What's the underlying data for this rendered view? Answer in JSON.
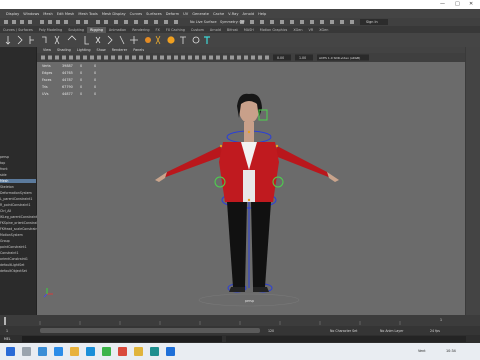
{
  "window": {
    "menus": [
      "Display",
      "Windows",
      "Mesh",
      "Edit Mesh",
      "Mesh Tools",
      "Mesh Display",
      "Curves",
      "Surfaces",
      "Deform",
      "UV",
      "Generate",
      "Cache",
      "V-Ray",
      "Arnold",
      "Help"
    ],
    "controls": [
      "—",
      "□",
      "✕"
    ]
  },
  "statusline": {
    "surface_label": "No Live Surface",
    "symmetry_label": "Symmetry: Off",
    "signin_label": "Sign In"
  },
  "shelf": {
    "tabs": [
      "Curves / Surfaces",
      "Poly Modeling",
      "Sculpting",
      "Rigging",
      "Animation",
      "Rendering",
      "FX",
      "FX Caching",
      "Custom",
      "Arnold",
      "Bifrost",
      "MASH",
      "Motion Graphics",
      "XGen",
      "VR",
      "XGen"
    ],
    "active_tab_index": 3
  },
  "outliner": {
    "items": [
      {
        "label": "persp",
        "selected": false
      },
      {
        "label": "top",
        "selected": false
      },
      {
        "label": "front",
        "selected": false
      },
      {
        "label": "side",
        "selected": false
      },
      {
        "label": "Mesh",
        "selected": true
      },
      {
        "label": "Skeleton",
        "selected": false
      },
      {
        "label": "DeformationSystem",
        "selected": false
      },
      {
        "label": "L_parentConstraint1",
        "selected": false
      },
      {
        "label": "R_pointConstraint1",
        "selected": false
      },
      {
        "label": "Ctrl_All",
        "selected": false
      },
      {
        "label": "IKLeg_parentConstraint1",
        "selected": false
      },
      {
        "label": "FKSpine_orientConstraint1",
        "selected": false
      },
      {
        "label": "FKHead_scaleConstraint1",
        "selected": false
      },
      {
        "label": "MotionSystem",
        "selected": false
      },
      {
        "label": "Group",
        "selected": false
      },
      {
        "label": "pointConstraint1",
        "selected": false
      },
      {
        "label": "Constraint1",
        "selected": false
      },
      {
        "label": "orientConstraint1",
        "selected": false
      },
      {
        "label": "defaultLightSet",
        "selected": false
      },
      {
        "label": "defaultObjectSet",
        "selected": false
      }
    ]
  },
  "viewport": {
    "menus": [
      "View",
      "Shading",
      "Lighting",
      "Show",
      "Renderer",
      "Panels"
    ],
    "camera_label": "persp",
    "hud": [
      {
        "label": "Verts",
        "v1": "39887",
        "v2": "0",
        "v3": "0"
      },
      {
        "label": "Edges",
        "v1": "44765",
        "v2": "0",
        "v3": "0"
      },
      {
        "label": "Faces",
        "v1": "44787",
        "v2": "0",
        "v3": "0"
      },
      {
        "label": "Tris",
        "v1": "67790",
        "v2": "0",
        "v3": "0"
      },
      {
        "label": "UVs",
        "v1": "44877",
        "v2": "0",
        "v3": "0"
      }
    ],
    "toolbar_value_a": "0.00",
    "toolbar_value_b": "1.00",
    "colorspace_label": "ACES 1.0 SDR-video (sRGB)"
  },
  "timeline": {
    "start": "1",
    "end": "120",
    "current": "1"
  },
  "rangebar": {
    "char_set": "No Character Set",
    "anim_layer": "No Anim Layer",
    "fps": "24 fps"
  },
  "cmdline": {
    "language": "MEL"
  },
  "taskbar": {
    "weather": "Vent",
    "time": "10:34"
  },
  "colors": {
    "maya_bg": "#6b6b6b",
    "ui_dark": "#3a3a3a",
    "selection": "#5b7a9c",
    "jacket_red": "#c01a1f",
    "rig_blue": "#2a3fd8",
    "rig_green": "#4cd34c"
  }
}
